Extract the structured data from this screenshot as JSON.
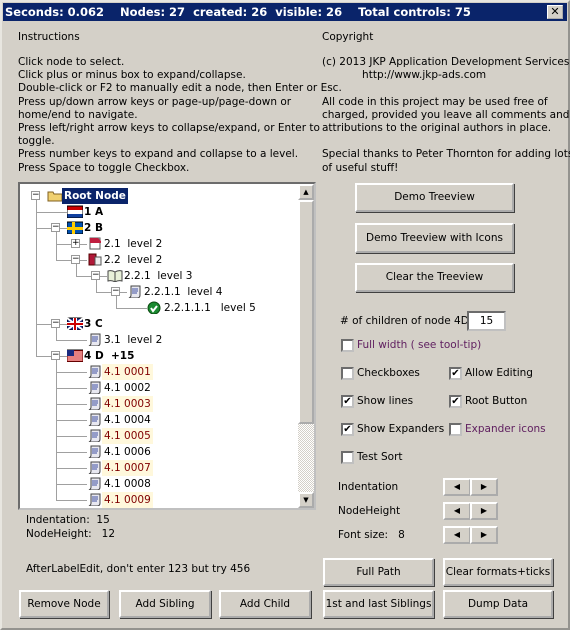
{
  "title": "Seconds: 0.062    Nodes: 27  created: 26  visible: 26    Total controls: 75",
  "instructions": {
    "heading": "Instructions",
    "lines": [
      "Click node to select.",
      "Click plus or minus box to expand/collapse.",
      "Double-click or F2 to manually edit a node, then Enter or Esc.",
      "Press up/down arrow keys or page-up/page-down or",
      "home/end to navigate.",
      "Press left/right arrow keys to collapse/expand, or Enter to",
      "toggle.",
      "Press number keys to expand and collapse to a level.",
      "Press Space to toggle Checkbox."
    ]
  },
  "copyright": {
    "heading": "Copyright",
    "lines": [
      "(c) 2013 JKP Application Development Services",
      "            http://www.jkp-ads.com",
      "",
      "All code in this project may be used free of",
      "charged, provided you leave all comments and",
      "attributions to the original authors in place.",
      "",
      "Special thanks to Peter Thornton for adding lots",
      "of useful stuff!"
    ]
  },
  "tree": {
    "nodes": [
      {
        "level": 0,
        "label": "Root Node",
        "bold": true,
        "exp": "-",
        "icon": "folder",
        "selected": true
      },
      {
        "level": 1,
        "label": "1 A",
        "bold": true,
        "icon": "flag-nl"
      },
      {
        "level": 1,
        "label": "2 B",
        "bold": true,
        "exp": "-",
        "icon": "flag-se"
      },
      {
        "level": 2,
        "label": "2.1  level 2",
        "exp": "+",
        "icon": "book-closed"
      },
      {
        "level": 2,
        "label": "2.2  level 2",
        "exp": "-",
        "icon": "book-red"
      },
      {
        "level": 3,
        "label": "2.2.1  level 3",
        "exp": "-",
        "icon": "book-open"
      },
      {
        "level": 4,
        "label": "2.2.1.1  level 4",
        "exp": "-",
        "icon": "scroll"
      },
      {
        "level": 5,
        "label": "2.2.1.1.1   level 5",
        "icon": "check"
      },
      {
        "level": 1,
        "label": "3 C",
        "bold": true,
        "exp": "-",
        "icon": "flag-uk"
      },
      {
        "level": 2,
        "label": "3.1  level 2",
        "icon": "scroll"
      },
      {
        "level": 1,
        "label": "4 D  +15",
        "bold": true,
        "exp": "-",
        "icon": "flag-us"
      },
      {
        "level": 2,
        "label": "4.1 0001",
        "icon": "scroll",
        "hi": true
      },
      {
        "level": 2,
        "label": "4.1 0002",
        "icon": "scroll"
      },
      {
        "level": 2,
        "label": "4.1 0003",
        "icon": "scroll",
        "hi": true
      },
      {
        "level": 2,
        "label": "4.1 0004",
        "icon": "scroll"
      },
      {
        "level": 2,
        "label": "4.1 0005",
        "icon": "scroll",
        "hi": true
      },
      {
        "level": 2,
        "label": "4.1 0006",
        "icon": "scroll"
      },
      {
        "level": 2,
        "label": "4.1 0007",
        "icon": "scroll",
        "hi": true
      },
      {
        "level": 2,
        "label": "4.1 0008",
        "icon": "scroll"
      },
      {
        "level": 2,
        "label": "4.1 0009",
        "icon": "scroll",
        "hi": true
      }
    ],
    "highlight_color": "#800000",
    "highlight_bg": "#fff8dc"
  },
  "status": {
    "indentation": "Indentation:  15",
    "nodeheight": "NodeHeight:   12",
    "after_edit": "AfterLabelEdit, don't enter 123 but try 456"
  },
  "buttons": {
    "demo": "Demo Treeview",
    "demo_icons": "Demo Treeview with Icons",
    "clear": "Clear the Treeview",
    "full_path": "Full Path",
    "clear_formats": "Clear formats+ticks",
    "remove": "Remove Node",
    "add_sibling": "Add Sibling",
    "add_child": "Add Child",
    "siblings": "1st and last Siblings",
    "dump": "Dump Data"
  },
  "options": {
    "children_label": "# of children of node 4D",
    "children_value": "15",
    "full_width": "Full width ( see tool-tip)",
    "checkboxes": "Checkboxes",
    "allow_editing": "Allow Editing",
    "show_lines": "Show lines",
    "root_button": "Root Button",
    "show_expanders": "Show Expanders",
    "expander_icons": "Expander icons",
    "test_sort": "Test Sort",
    "indentation": "Indentation",
    "nodeheight": "NodeHeight",
    "font_size": "Font size:   8"
  },
  "checked": {
    "full_width": false,
    "checkboxes": false,
    "allow_editing": true,
    "show_lines": true,
    "root_button": true,
    "show_expanders": true,
    "expander_icons": false,
    "test_sort": false
  }
}
